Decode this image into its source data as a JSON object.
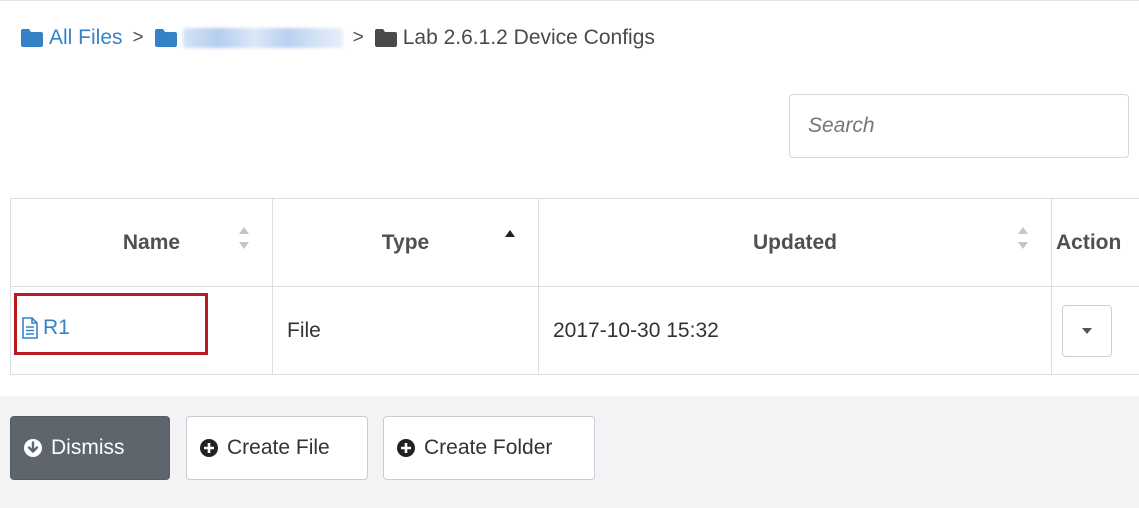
{
  "breadcrumb": {
    "items": [
      {
        "label": "All Files",
        "icon": "folder-icon",
        "color": "#3583c7"
      },
      {
        "label": "",
        "icon": "folder-icon",
        "color": "#3583c7",
        "obscured": true
      },
      {
        "label": "Lab 2.6.1.2 Device Configs",
        "icon": "folder-icon",
        "color": "#4a4a4a"
      }
    ],
    "separator": ">"
  },
  "search": {
    "placeholder": "Search",
    "value": ""
  },
  "table": {
    "columns": [
      {
        "label": "Name",
        "sort": "both"
      },
      {
        "label": "Type",
        "sort": "asc"
      },
      {
        "label": "Updated",
        "sort": "both"
      },
      {
        "label": "Action",
        "sort": "none"
      }
    ],
    "rows": [
      {
        "name": "R1",
        "icon": "file-text-icon",
        "type": "File",
        "updated": "2017-10-30 15:32",
        "action_icon": "caret-down-icon"
      }
    ]
  },
  "buttons": {
    "dismiss": {
      "label": "Dismiss",
      "icon": "circle-arrow-down-icon"
    },
    "create_file": {
      "label": "Create File",
      "icon": "plus-circle-icon"
    },
    "create_folder": {
      "label": "Create Folder",
      "icon": "plus-circle-icon"
    }
  },
  "colors": {
    "link": "#3583c7",
    "highlight": "#b81c22",
    "dismiss_bg": "#5e656d",
    "page_bg": "#f2f3f5"
  }
}
